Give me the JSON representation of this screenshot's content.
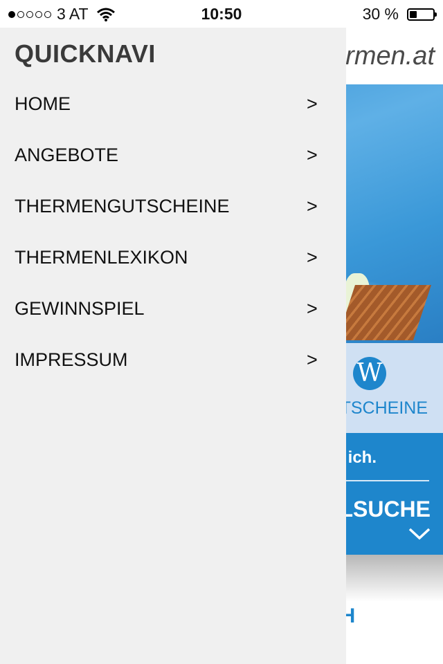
{
  "status_bar": {
    "carrier": "3 AT",
    "signal_full_dots": 1,
    "signal_total_dots": 5,
    "time": "10:50",
    "battery_text": "30 %",
    "battery_level": 0.3,
    "icons": {
      "wifi": "wifi-icon",
      "battery": "battery-icon"
    }
  },
  "background_page": {
    "logo_text": "rmen.at",
    "voucher_badge": "W",
    "voucher_text": "TSCHEINE",
    "search_band_text": "ich.",
    "search_band_title": "LSUCHE",
    "bottom_text": "CH",
    "colors": {
      "brand_blue": "#1e86cc",
      "band_light": "#cfe0f3"
    }
  },
  "drawer": {
    "title": "QUICKNAVI",
    "arrow": ">",
    "items": [
      {
        "label": "HOME"
      },
      {
        "label": "ANGEBOTE"
      },
      {
        "label": "THERMENGUTSCHEINE"
      },
      {
        "label": "THERMENLEXIKON"
      },
      {
        "label": "GEWINNSPIEL"
      },
      {
        "label": "IMPRESSUM"
      }
    ]
  }
}
